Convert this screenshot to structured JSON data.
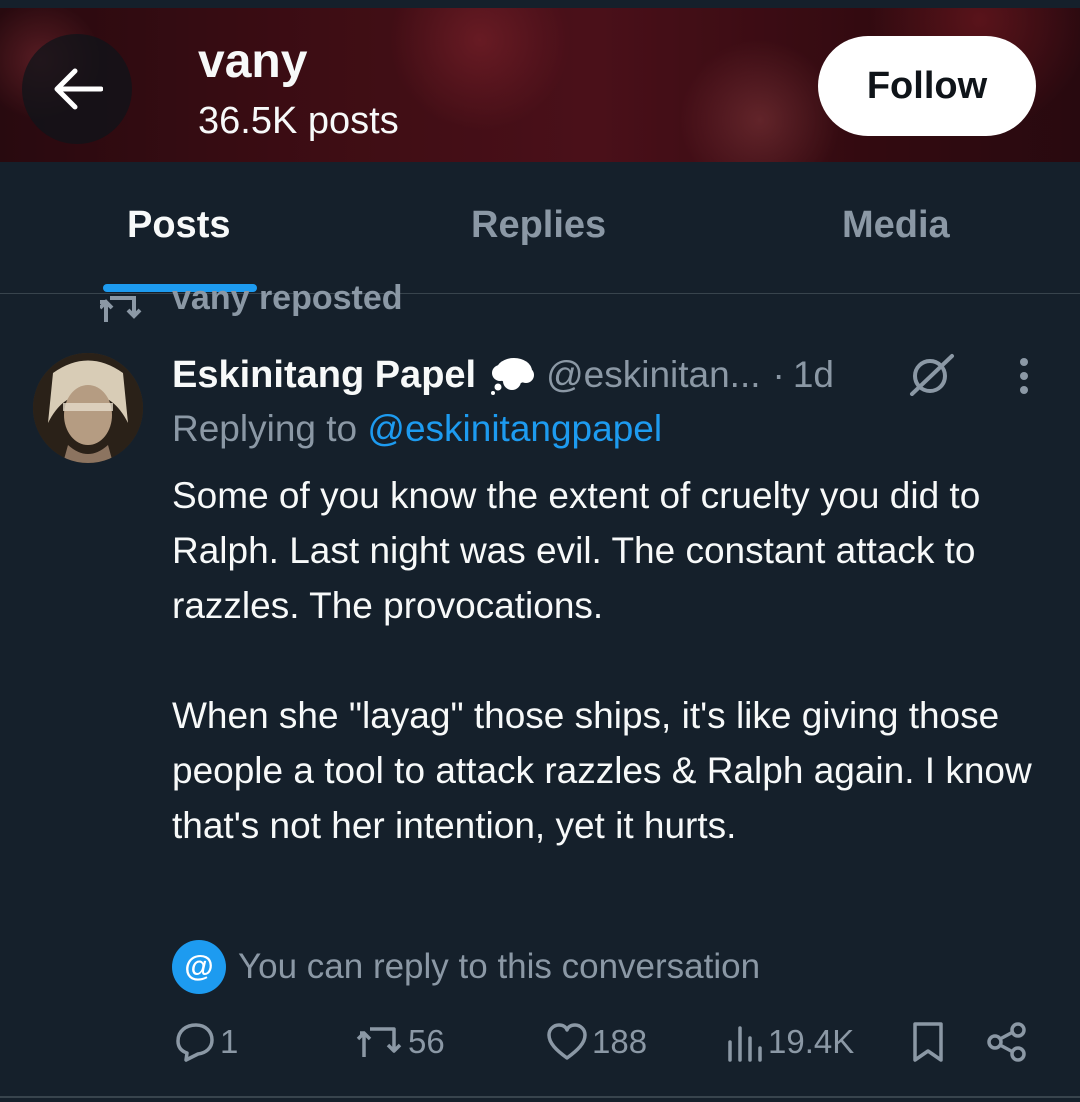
{
  "header": {
    "title": "vany",
    "post_count": "36.5K posts",
    "follow_label": "Follow"
  },
  "tabs": [
    {
      "label": "Posts",
      "active": true
    },
    {
      "label": "Replies",
      "active": false
    },
    {
      "label": "Media",
      "active": false
    }
  ],
  "repost": {
    "text": "vany reposted"
  },
  "tweet": {
    "author_name": "Eskinitang Papel",
    "badge_icon": "thought-bubble-icon",
    "handle": "@eskinitan...",
    "separator": "·",
    "time": "1d",
    "replying_prefix": "Replying to ",
    "replying_to": "@eskinitangpapel",
    "paragraphs": [
      "Some of you know the extent of cruelty you did to Ralph. Last night was evil. The constant attack to razzles. The provocations.",
      "When she \"layag\" those ships, it's like giving those people a tool to attack razzles & Ralph again. I know that's not her intention, yet it hurts."
    ],
    "reply_note": "You can reply to this conversation",
    "reply_note_icon": "@",
    "stats": {
      "replies": "1",
      "reposts": "56",
      "likes": "188",
      "views": "19.4K"
    }
  },
  "colors": {
    "background": "#15202b",
    "accent": "#1d9bf0",
    "secondary_text": "#8b98a5",
    "primary_text": "#f7f9f9",
    "divider": "#38444d"
  }
}
